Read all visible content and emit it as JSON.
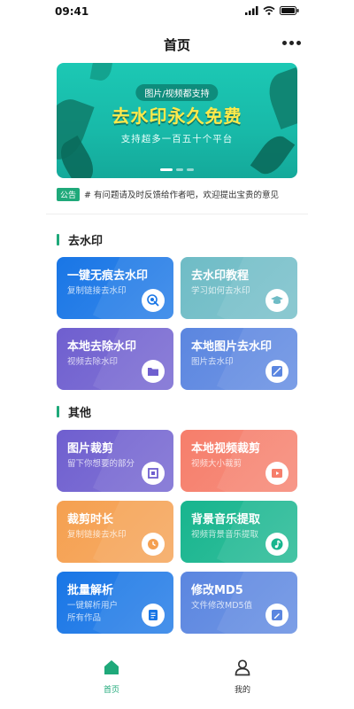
{
  "status_bar": {
    "time": "09:41"
  },
  "nav": {
    "title": "首页"
  },
  "banner": {
    "tag": "图片/视频都支持",
    "headline": "去水印永久免费",
    "subtitle": "支持超多一百五十个平台"
  },
  "notice": {
    "badge": "公告",
    "text": "# 有问题请及时反馈给作者吧，欢迎提出宝贵的意见"
  },
  "sections": [
    {
      "title": "去水印"
    },
    {
      "title": "其他"
    }
  ],
  "cards": [
    {
      "title": "一键无痕去水印",
      "subtitle": "复制链接去水印",
      "icon": "link-touch-icon",
      "color": "#1976e6"
    },
    {
      "title": "去水印教程",
      "subtitle": "学习如何去水印",
      "icon": "graduation-cap-icon",
      "color": "#6fbcc6"
    },
    {
      "title": "本地去除水印",
      "subtitle": "视频去除水印",
      "icon": "folder-icon",
      "color": "#6f5fcf"
    },
    {
      "title": "本地图片去水印",
      "subtitle": "图片去水印",
      "icon": "image-icon",
      "color": "#5b86e0"
    },
    {
      "title": "图片裁剪",
      "subtitle": "留下你想要的部分",
      "icon": "crop-icon",
      "color": "#6f5fcf"
    },
    {
      "title": "本地视频裁剪",
      "subtitle": "视频大小裁剪",
      "icon": "video-icon",
      "color": "#f67e6b"
    },
    {
      "title": "裁剪时长",
      "subtitle": "复制链接去水印",
      "icon": "clock-icon",
      "color": "#f5a050"
    },
    {
      "title": "背景音乐提取",
      "subtitle": "视频背景音乐提取",
      "icon": "music-icon",
      "color": "#17b58e"
    },
    {
      "title": "批量解析",
      "subtitle": "一键解析用户\n所有作品",
      "icon": "document-icon",
      "color": "#1976e6"
    },
    {
      "title": "修改MD5",
      "subtitle": "文件修改MD5值",
      "icon": "edit-icon",
      "color": "#5b86e0"
    }
  ],
  "tabbar": [
    {
      "label": "首页",
      "icon": "home-icon",
      "active": true,
      "color": "#1fa97a"
    },
    {
      "label": "我的",
      "icon": "user-icon",
      "active": false,
      "color": "#333333"
    }
  ]
}
